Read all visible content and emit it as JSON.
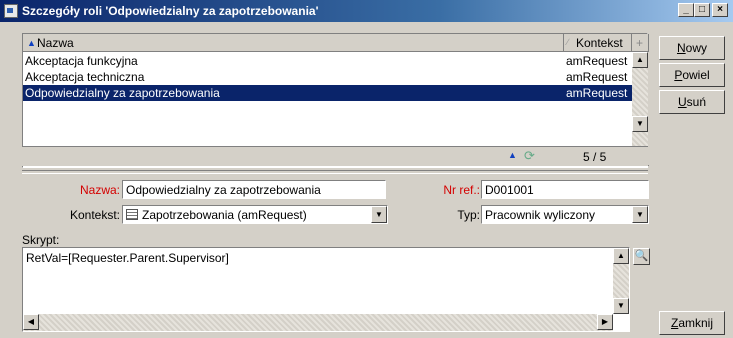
{
  "window": {
    "title": "Szczegóły roli 'Odpowiedzialny za zapotrzebowania'",
    "minimize": "_",
    "maximize": "□",
    "close": "×"
  },
  "list": {
    "columns": [
      "Nazwa",
      "Kontekst"
    ],
    "rows": [
      {
        "name": "Akceptacja funkcyjna",
        "context": "amRequest"
      },
      {
        "name": "Akceptacja techniczna",
        "context": "amRequest"
      },
      {
        "name": "Odpowiedzialny za zapotrzebowania",
        "context": "amRequest",
        "selected": true
      }
    ],
    "counter": "5 / 5"
  },
  "buttons": {
    "new_pre": "",
    "new_ul": "N",
    "new_post": "owy",
    "dup_pre": "",
    "dup_ul": "P",
    "dup_post": "owiel",
    "del_pre": "",
    "del_ul": "U",
    "del_post": "suń",
    "close_pre": "",
    "close_ul": "Z",
    "close_post": "amknij"
  },
  "form": {
    "name_label": "Nazwa:",
    "name_value": "Odpowiedzialny za zapotrzebowania",
    "ref_label": "Nr ref.:",
    "ref_value": "D001001",
    "context_label": "Kontekst:",
    "context_value": "Zapotrzebowania (amRequest)",
    "type_label": "Typ:",
    "type_value": "Pracownik wyliczony",
    "script_label": "Skrypt:",
    "script_value": "RetVal=[Requester.Parent.Supervisor]"
  },
  "colors": {
    "title_start": "#0a246a",
    "title_end": "#a6caf0",
    "selection": "#0a246a",
    "required_label": "#d40000",
    "face": "#d4d0c8"
  }
}
